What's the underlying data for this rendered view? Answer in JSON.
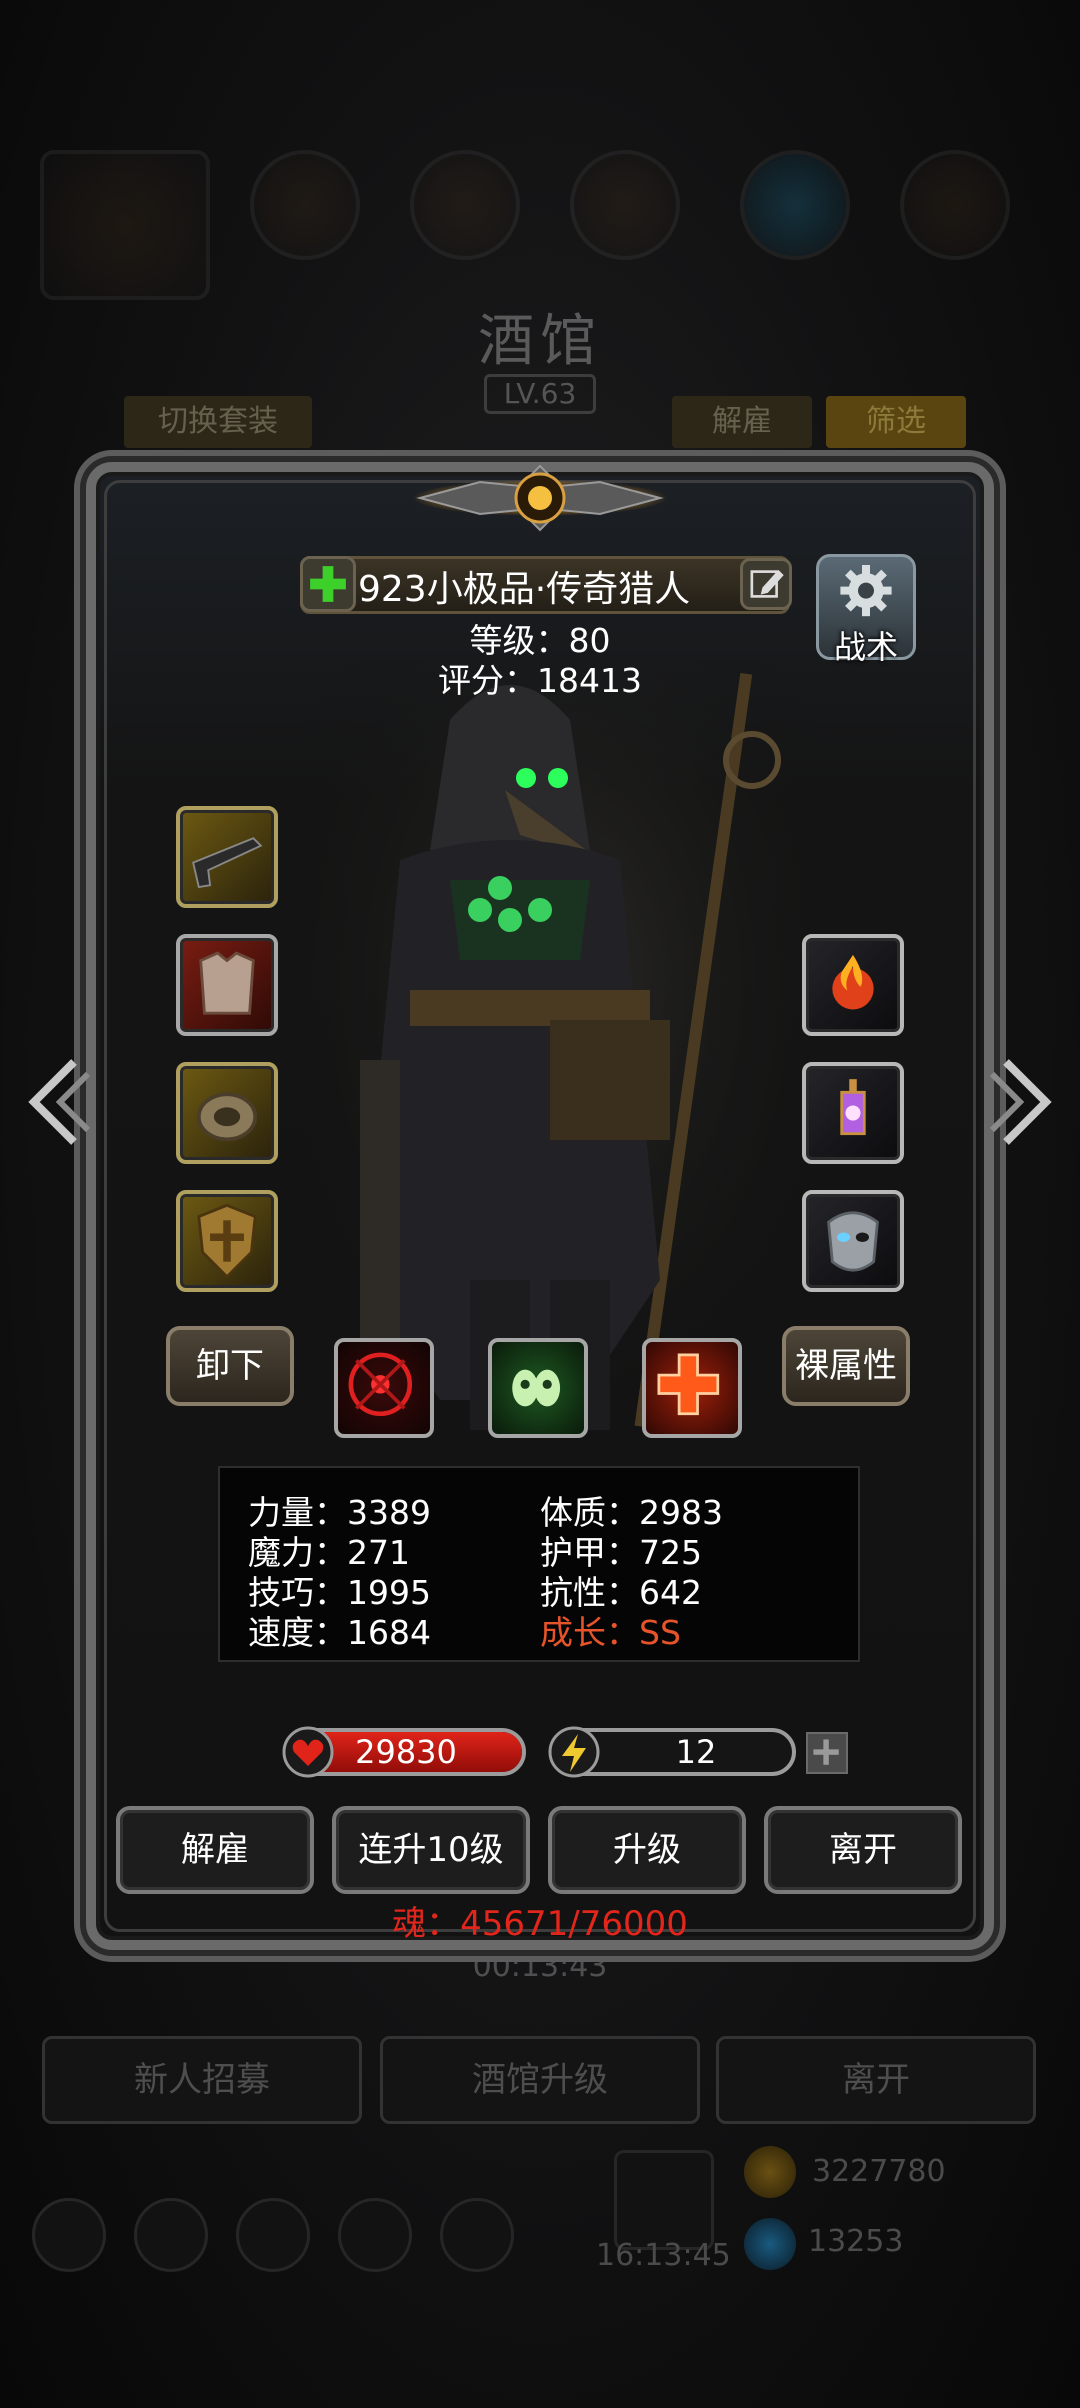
{
  "background": {
    "title": "酒馆",
    "level": "LV.63",
    "switch_outfit": "切换套装",
    "dismiss_tab": "解雇",
    "filter_tab": "筛选",
    "timer": "00:13:43",
    "buttons": [
      "新人招募",
      "酒馆升级",
      "离开"
    ],
    "clock": "16:13:45",
    "gold": "3227780",
    "gems": "13253"
  },
  "hero": {
    "name": "923小极品·传奇猎人",
    "level_line": "等级：80",
    "score_line": "评分：18413",
    "tactics_label": "战术"
  },
  "buttons": {
    "unequip": "卸下",
    "raw_attrs": "裸属性"
  },
  "attributes": {
    "strength": "力量：3389",
    "magic": "魔力：271",
    "skill": "技巧：1995",
    "speed": "速度：1684",
    "constitution": "体质：2983",
    "armor": "护甲：725",
    "resistance": "抗性：642",
    "growth": "成长：SS"
  },
  "bars": {
    "hp": "29830",
    "hp_fill": 1.0,
    "energy": "12",
    "energy_fill": 0.12
  },
  "actions": [
    "解雇",
    "连升10级",
    "升级",
    "离开"
  ],
  "soul": "魂：45671/76000",
  "colors": {
    "hp_red": "#e0241a",
    "energy_yellow": "#e8c430",
    "growth_orange": "#e8542a",
    "soul_red": "#e2261c"
  }
}
